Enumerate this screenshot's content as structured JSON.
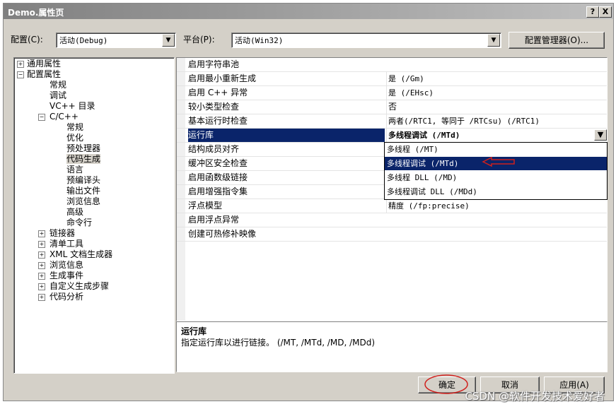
{
  "window": {
    "title": "Demo.属性页",
    "help_btn": "?",
    "close_btn": "X"
  },
  "config": {
    "label": "配置(C):",
    "value": "活动(Debug)"
  },
  "platform": {
    "label": "平台(P):",
    "value": "活动(Win32)"
  },
  "config_manager_btn": "配置管理器(O)...",
  "tree": {
    "general": "通用属性",
    "config_props": "配置属性",
    "normal": "常规",
    "debug": "调试",
    "vcdirs": "VC++ 目录",
    "cpp": "C/C++",
    "cpp_children": [
      "常规",
      "优化",
      "预处理器",
      "代码生成",
      "语言",
      "预编译头",
      "输出文件",
      "浏览信息",
      "高级",
      "命令行"
    ],
    "linker": "链接器",
    "manifest": "清单工具",
    "xml": "XML 文档生成器",
    "browse": "浏览信息",
    "build_events": "生成事件",
    "custom_build": "自定义生成步骤",
    "code_analysis": "代码分析"
  },
  "properties": [
    {
      "name": "启用字符串池",
      "value": ""
    },
    {
      "name": "启用最小重新生成",
      "value": "是 (/Gm)"
    },
    {
      "name": "启用 C++ 异常",
      "value": "是 (/EHsc)"
    },
    {
      "name": "较小类型检查",
      "value": "否"
    },
    {
      "name": "基本运行时检查",
      "value": "两者(/RTC1, 等同于 /RTCsu) (/RTC1)"
    },
    {
      "name": "运行库",
      "value": "多线程调试 (/MTd)"
    },
    {
      "name": "结构成员对齐",
      "value": ""
    },
    {
      "name": "缓冲区安全检查",
      "value": ""
    },
    {
      "name": "启用函数级链接",
      "value": ""
    },
    {
      "name": "启用增强指令集",
      "value": ""
    },
    {
      "name": "浮点模型",
      "value": "精度 (/fp:precise)"
    },
    {
      "name": "启用浮点异常",
      "value": ""
    },
    {
      "name": "创建可热修补映像",
      "value": ""
    }
  ],
  "dropdown_options": [
    "多线程 (/MT)",
    "多线程调试 (/MTd)",
    "多线程 DLL (/MD)",
    "多线程调试 DLL (/MDd)"
  ],
  "description": {
    "title": "运行库",
    "body": "指定运行库以进行链接。    (/MT, /MTd, /MD, /MDd)"
  },
  "buttons": {
    "ok": "确定",
    "cancel": "取消",
    "apply": "应用(A)"
  },
  "watermark": "CSDN @软件开发技术爱好者",
  "colors": {
    "selection": "#0a246a",
    "face": "#d4d0c8",
    "annotation_red": "#d0201c"
  }
}
